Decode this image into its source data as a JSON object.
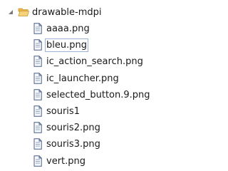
{
  "tree": {
    "folder": {
      "label": "drawable-mdpi",
      "expanded": true,
      "icon": "open-folder-icon"
    },
    "files": [
      {
        "label": "aaaa.png",
        "icon": "file-icon"
      },
      {
        "label": "bleu.png",
        "icon": "file-icon",
        "focused": true
      },
      {
        "label": "ic_action_search.png",
        "icon": "file-icon"
      },
      {
        "label": "ic_launcher.png",
        "icon": "file-icon"
      },
      {
        "label": "selected_button.9.png",
        "icon": "file-icon"
      },
      {
        "label": "souris1",
        "icon": "file-icon"
      },
      {
        "label": "souris2.png",
        "icon": "file-icon"
      },
      {
        "label": "souris3.png",
        "icon": "file-icon"
      },
      {
        "label": "vert.png",
        "icon": "file-icon"
      }
    ]
  },
  "colors": {
    "folder_fill": "#f2c65a",
    "folder_stroke": "#c9952c",
    "file_stroke": "#4a5f86",
    "file_fill": "#f6f8fc",
    "focus_border": "#9db3d6"
  }
}
